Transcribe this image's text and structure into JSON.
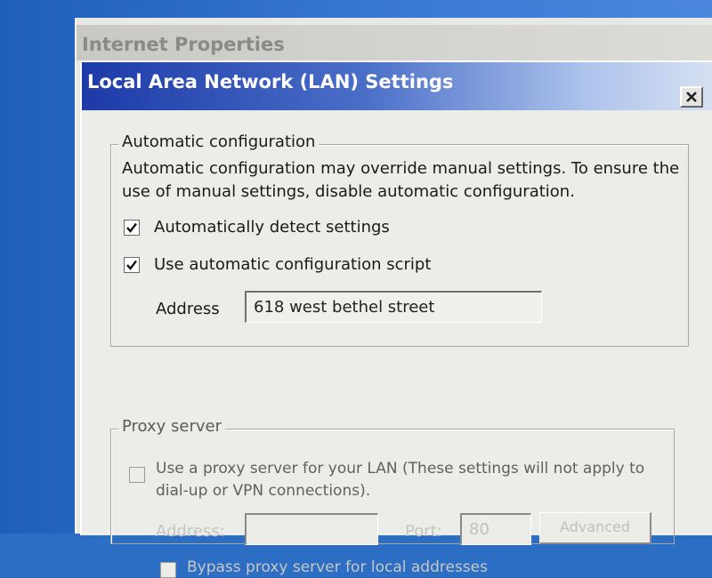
{
  "parent_window": {
    "title": "Internet Properties",
    "help_label": "?"
  },
  "dialog": {
    "title": "Local Area Network (LAN) Settings",
    "close_label": "X"
  },
  "auto_config": {
    "legend": "Automatic configuration",
    "description": "Automatic configuration may override manual settings.  To ensure the use of manual settings, disable automatic configuration.",
    "detect_settings": {
      "label": "Automatically detect settings",
      "checked": true
    },
    "use_script": {
      "label": "Use automatic configuration script",
      "checked": true
    },
    "address_label": "Address",
    "address_value": "618 west bethel street"
  },
  "proxy": {
    "legend": "Proxy server",
    "use_proxy": {
      "label": "Use a proxy server for your LAN (These settings will not apply to dial-up or VPN connections).",
      "checked": false
    },
    "address_label": "Address:",
    "address_value": "",
    "port_label": "Port:",
    "port_value": "80",
    "advanced_label": "Advanced",
    "bypass": {
      "label": "Bypass proxy server for local addresses",
      "checked": false
    }
  },
  "colors": {
    "title_active_start": "#1d3aa8",
    "title_active_end": "#d6e0f2",
    "desktop": "#2b6ec4",
    "window_bg": "#ecece8",
    "disabled_text": "#c0c0bc"
  },
  "icons": {
    "check": "checkmark-icon",
    "close": "close-icon",
    "help": "help-icon"
  }
}
